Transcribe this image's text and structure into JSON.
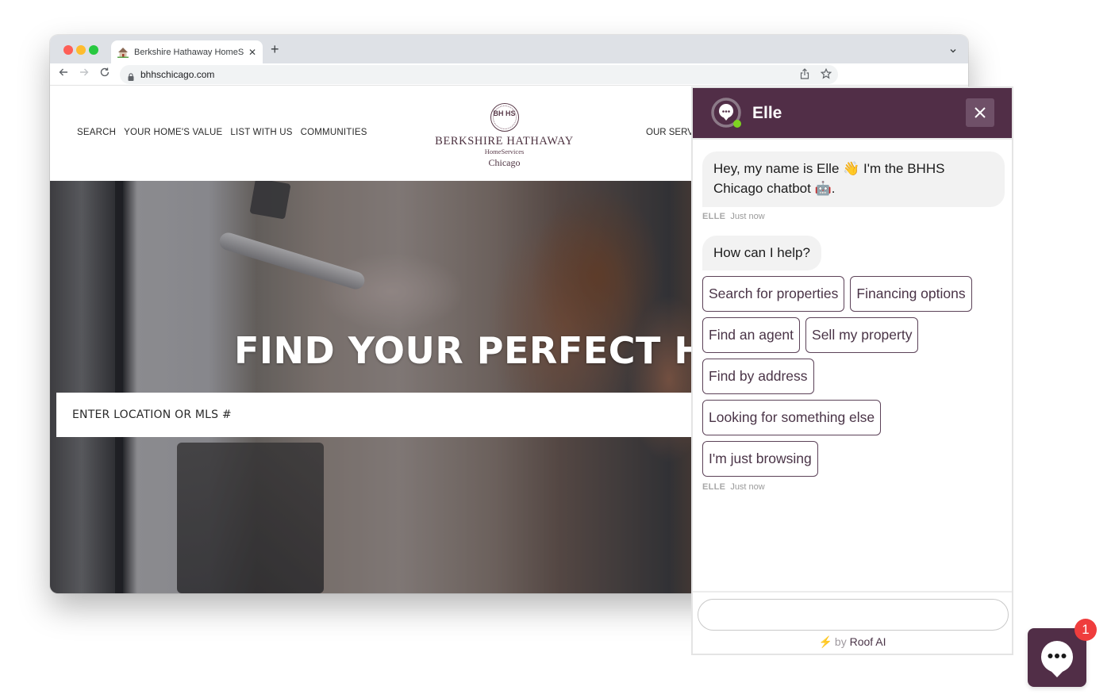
{
  "browser": {
    "tab_title": "Berkshire Hathaway HomeServices Chicago",
    "tab_favicon": "house-favicon-icon",
    "new_tab_label": "+",
    "url": "bhhschicago.com"
  },
  "site": {
    "nav_left": [
      "SEARCH",
      "YOUR HOME'S VALUE",
      "LIST WITH US",
      "COMMUNITIES"
    ],
    "nav_right": "OUR SERV",
    "logo": {
      "seal_text": "BH HS",
      "name": "BERKSHIRE HATHAWAY",
      "sub": "HomeServices",
      "city": "Chicago"
    },
    "hero_title": "FIND YOUR PERFECT H",
    "search_placeholder": "ENTER LOCATION OR MLS #"
  },
  "chat": {
    "bot_name": "Elle",
    "status_color": "#7ed321",
    "brand_color": "#512e47",
    "messages": [
      {
        "text": "Hey, my name is Elle 👋 I'm the BHHS Chicago chatbot 🤖."
      },
      {
        "text": "How can I help?"
      }
    ],
    "meta": [
      {
        "sender": "ELLE",
        "time": "Just now"
      },
      {
        "sender": "ELLE",
        "time": "Just now"
      }
    ],
    "quick_replies": [
      [
        "Search for properties",
        "Financing options"
      ],
      [
        "Find an agent",
        "Sell my property"
      ],
      [
        "Find by address"
      ],
      [
        "Looking for something else"
      ],
      [
        "I'm just browsing"
      ]
    ],
    "input_placeholder": "",
    "powered_by_prefix": "by",
    "powered_by_brand": "Roof AI"
  },
  "launcher": {
    "badge_count": "1"
  }
}
